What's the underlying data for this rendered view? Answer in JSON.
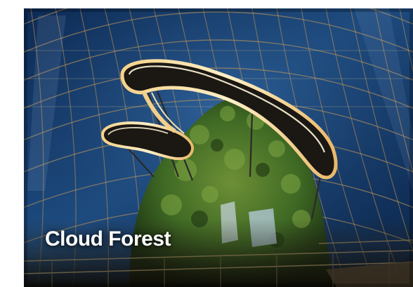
{
  "card": {
    "title": "Cloud Forest",
    "image_subject": "dome-conservatory-with-lit-skywalk-and-vertical-garden",
    "colors": {
      "caption_text": "#ffffff",
      "glass_dome": "#1f4f86",
      "skywalk_light": "#f4d79c",
      "foliage": "#3f6a24"
    }
  }
}
